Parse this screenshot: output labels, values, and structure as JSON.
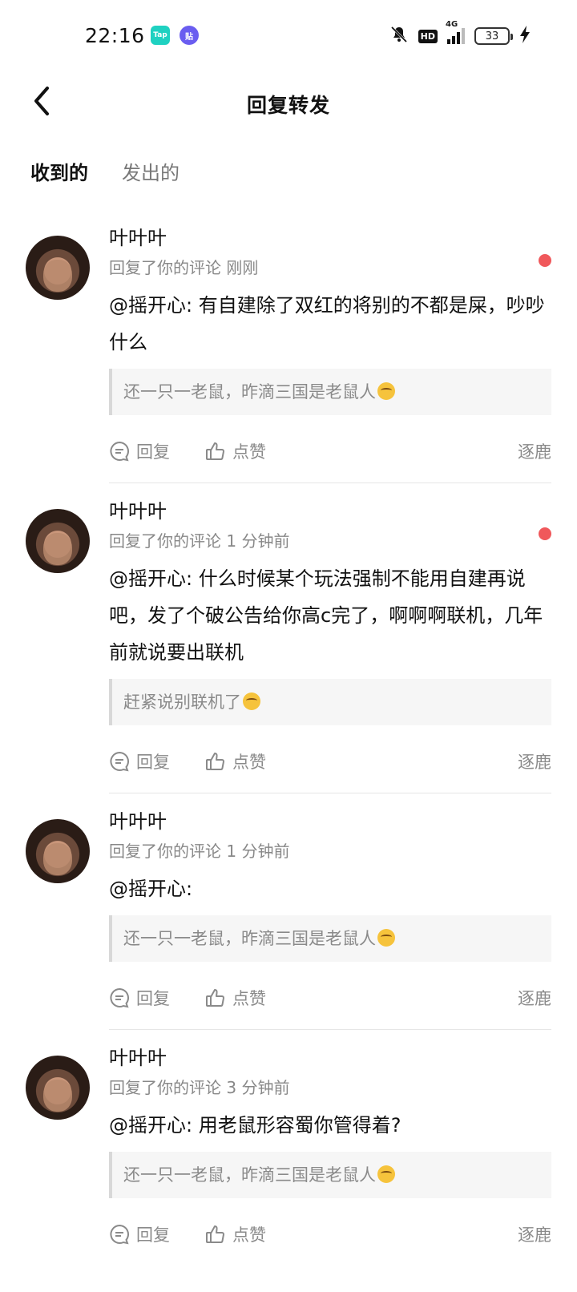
{
  "status_bar": {
    "time": "22:16",
    "apps": [
      {
        "name": "tap-app-icon",
        "label": "Tap"
      },
      {
        "name": "tieba-app-icon",
        "label": "贴"
      }
    ],
    "hd": "HD",
    "network": "4G",
    "battery": "33",
    "icons": [
      "mute-bell-icon",
      "hd-icon",
      "signal-icon",
      "battery-icon",
      "charging-bolt-icon"
    ]
  },
  "header": {
    "back_icon": "chevron-left-icon",
    "title": "回复转发"
  },
  "tabs": [
    {
      "label": "收到的",
      "active": true
    },
    {
      "label": "发出的",
      "active": false
    }
  ],
  "items": [
    {
      "user": "叶叶叶",
      "meta": "回复了你的评论 刚刚",
      "content": "@摇开心: 有自建除了双红的将别的不都是屎，吵吵什么",
      "quote": "还一只一老鼠，昨滴三国是老鼠人",
      "unread": true,
      "reply_label": "回复",
      "like_label": "点赞",
      "source_label": "逐鹿"
    },
    {
      "user": "叶叶叶",
      "meta": "回复了你的评论 1 分钟前",
      "content": "@摇开心: 什么时候某个玩法强制不能用自建再说吧，发了个破公告给你高c完了，啊啊啊联机，几年前就说要出联机",
      "quote": "赶紧说别联机了",
      "unread": true,
      "reply_label": "回复",
      "like_label": "点赞",
      "source_label": "逐鹿"
    },
    {
      "user": "叶叶叶",
      "meta": "回复了你的评论 1 分钟前",
      "content": "@摇开心:",
      "quote": "还一只一老鼠，昨滴三国是老鼠人",
      "unread": false,
      "reply_label": "回复",
      "like_label": "点赞",
      "source_label": "逐鹿"
    },
    {
      "user": "叶叶叶",
      "meta": "回复了你的评论 3 分钟前",
      "content": "@摇开心: 用老鼠形容蜀你管得着?",
      "quote": "还一只一老鼠，昨滴三国是老鼠人",
      "unread": false,
      "reply_label": "回复",
      "like_label": "点赞",
      "source_label": "逐鹿"
    }
  ],
  "colors": {
    "accent": "#18c6b6",
    "unread_dot": "#f0585b",
    "secondary_text": "#888888"
  }
}
